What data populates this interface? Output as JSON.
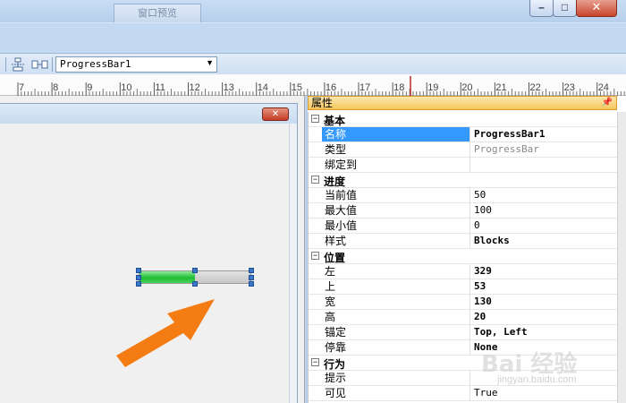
{
  "window": {
    "title": "窗口预览"
  },
  "toolbar": {
    "control_combo_value": "ProgressBar1"
  },
  "ruler": {
    "ticks": [
      "7",
      "8",
      "9",
      "10",
      "11",
      "12",
      "13",
      "14",
      "15",
      "16",
      "17",
      "18",
      "19",
      "20",
      "21",
      "22",
      "23",
      "24"
    ]
  },
  "form": {
    "close_label": "✕"
  },
  "progressbar": {
    "value": 50,
    "maximum": 100,
    "accent": "#1dbd32"
  },
  "properties": {
    "title": "属性",
    "sections": [
      {
        "label": "基本",
        "items": [
          {
            "name": "名称",
            "value": "ProgressBar1",
            "style": "bold",
            "selected": true
          },
          {
            "name": "类型",
            "value": "ProgressBar",
            "style": "gray"
          },
          {
            "name": "绑定到",
            "value": ""
          }
        ]
      },
      {
        "label": "进度",
        "items": [
          {
            "name": "当前值",
            "value": "50"
          },
          {
            "name": "最大值",
            "value": "100"
          },
          {
            "name": "最小值",
            "value": "0"
          },
          {
            "name": "样式",
            "value": "Blocks",
            "style": "bold"
          }
        ]
      },
      {
        "label": "位置",
        "items": [
          {
            "name": "左",
            "value": "329",
            "style": "bold"
          },
          {
            "name": "上",
            "value": "53",
            "style": "bold"
          },
          {
            "name": "宽",
            "value": "130",
            "style": "bold"
          },
          {
            "name": "高",
            "value": "20",
            "style": "bold"
          },
          {
            "name": "锚定",
            "value": "Top, Left",
            "style": "bold"
          },
          {
            "name": "停靠",
            "value": "None",
            "style": "bold"
          }
        ]
      },
      {
        "label": "行为",
        "items": [
          {
            "name": "提示",
            "value": ""
          },
          {
            "name": "可见",
            "value": "True"
          }
        ]
      }
    ]
  },
  "watermark": {
    "text": "Bai 经验",
    "sub": "jingyan.baidu.com"
  }
}
